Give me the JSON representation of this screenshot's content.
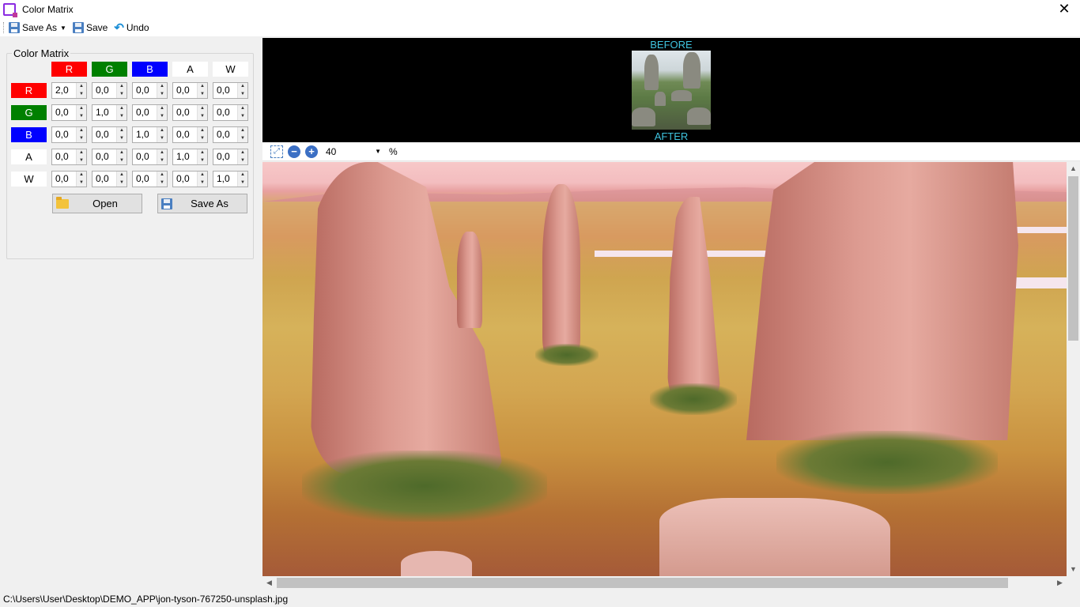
{
  "window": {
    "title": "Color Matrix",
    "close_glyph": "✕"
  },
  "toolbar": {
    "save_as_label": "Save As",
    "save_label": "Save",
    "undo_label": "Undo"
  },
  "matrix": {
    "group_title": "Color Matrix",
    "columns": [
      "R",
      "G",
      "B",
      "A",
      "W"
    ],
    "rows": [
      {
        "label": "R",
        "values": [
          "2,0",
          "0,0",
          "0,0",
          "0,0",
          "0,0"
        ]
      },
      {
        "label": "G",
        "values": [
          "0,0",
          "1,0",
          "0,0",
          "0,0",
          "0,0"
        ]
      },
      {
        "label": "B",
        "values": [
          "0,0",
          "0,0",
          "1,0",
          "0,0",
          "0,0"
        ]
      },
      {
        "label": "A",
        "values": [
          "0,0",
          "0,0",
          "0,0",
          "1,0",
          "0,0"
        ]
      },
      {
        "label": "W",
        "values": [
          "0,0",
          "0,0",
          "0,0",
          "0,0",
          "1,0"
        ]
      }
    ],
    "open_label": "Open",
    "save_as_label": "Save As"
  },
  "preview": {
    "before_label": "BEFORE",
    "after_label": "AFTER"
  },
  "zoom": {
    "fit_icon": "fit-to-window-icon",
    "zoom_out_glyph": "−",
    "zoom_in_glyph": "+",
    "value": "40",
    "unit": "%"
  },
  "status": {
    "path": "C:\\Users\\User\\Desktop\\DEMO_APP\\jon-tyson-767250-unsplash.jpg"
  },
  "colors": {
    "red": "#ff0000",
    "green": "#008000",
    "blue": "#0000ff",
    "label_cyan": "#3fc4e0"
  }
}
